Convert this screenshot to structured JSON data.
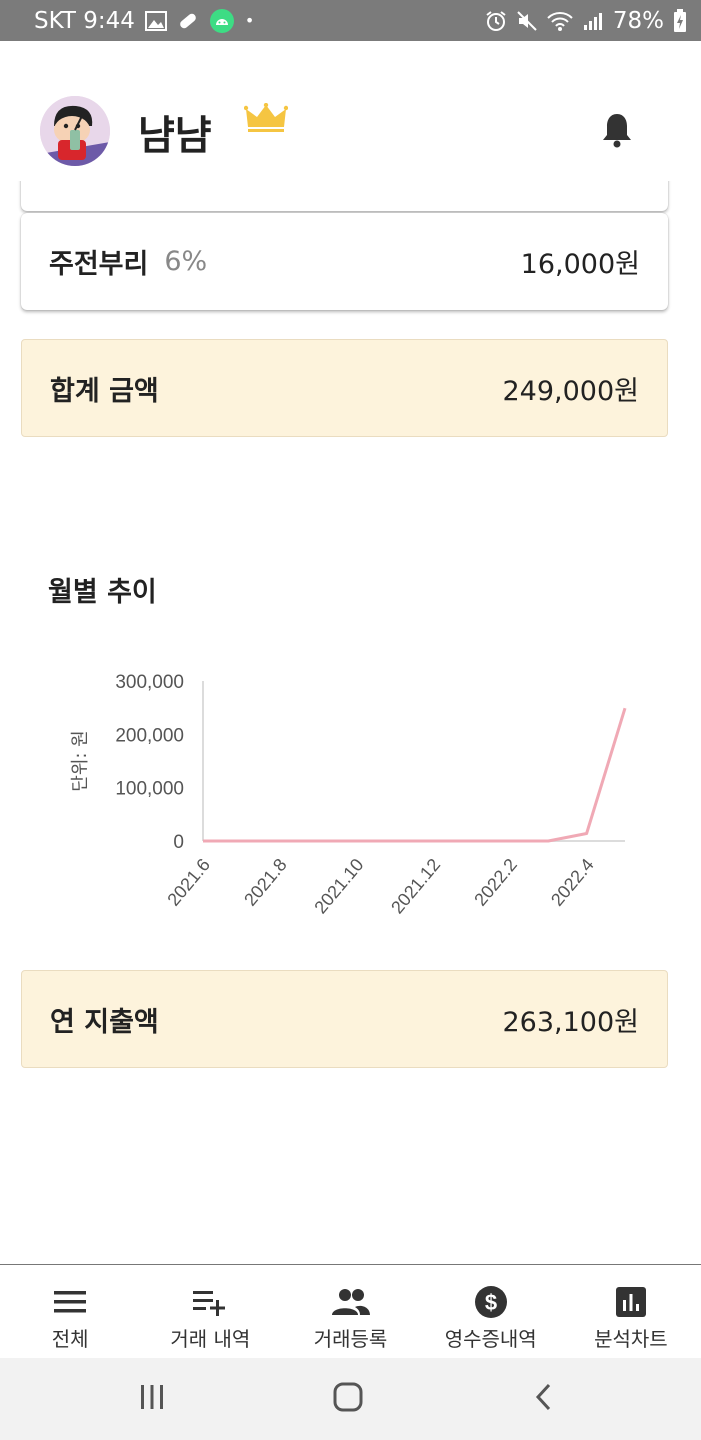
{
  "status_bar": {
    "carrier_time": "SKT 9:44",
    "dot": "•",
    "battery": "78%",
    "icons": [
      "image-icon",
      "pill-icon",
      "android-icon",
      "alarm-icon",
      "mute-icon",
      "wifi-icon",
      "signal-icon",
      "battery-charging-icon"
    ]
  },
  "header": {
    "username": "냠냠",
    "crown_color": "#f5c542",
    "icons": [
      "avatar",
      "crown-icon",
      "bell-icon"
    ]
  },
  "items": [
    {
      "name": "주전부리",
      "percent": "6%",
      "amount": "16,000원"
    }
  ],
  "summary": {
    "total_label": "합계 금액",
    "total_value": "249,000원"
  },
  "trend": {
    "title": "월별 추이"
  },
  "annual": {
    "label": "연 지출액",
    "value": "263,100원"
  },
  "chart_data": {
    "type": "line",
    "ylabel": "단위: 원",
    "ylim": [
      0,
      300000
    ],
    "y_ticks": [
      "300,000",
      "200,000",
      "100,000",
      "0"
    ],
    "x_ticks": [
      "2021.6",
      "2021.8",
      "2021.10",
      "2021.12",
      "2022.2",
      "2022.4"
    ],
    "x": [
      "2021.6",
      "2021.7",
      "2021.8",
      "2021.9",
      "2021.10",
      "2021.11",
      "2021.12",
      "2022.1",
      "2022.2",
      "2022.3",
      "2022.4",
      "2022.5"
    ],
    "series": [
      {
        "values": [
          0,
          0,
          0,
          0,
          0,
          0,
          0,
          0,
          0,
          0,
          14100,
          249000
        ]
      }
    ],
    "line_color": "#f0a9b5",
    "grid": false
  },
  "bottom_nav": [
    {
      "label": "전체",
      "icon": "menu-icon"
    },
    {
      "label": "거래 내역",
      "icon": "playlist-add-icon"
    },
    {
      "label": "거래등록",
      "icon": "people-icon"
    },
    {
      "label": "영수증내역",
      "icon": "dollar-circle-icon"
    },
    {
      "label": "분석차트",
      "icon": "bar-chart-icon"
    }
  ],
  "system_nav": [
    "recent-apps-icon",
    "home-icon",
    "back-icon"
  ]
}
